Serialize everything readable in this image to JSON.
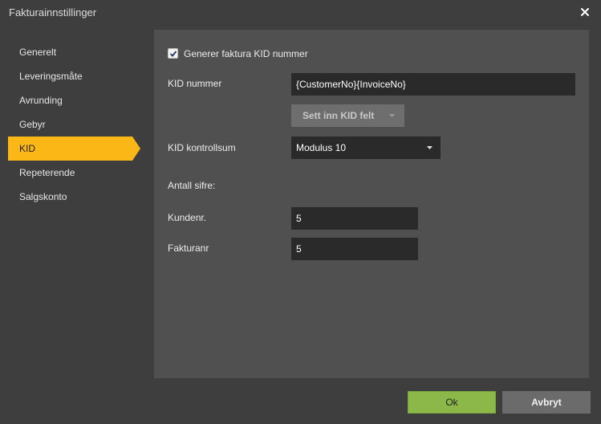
{
  "window": {
    "title": "Fakturainnstillinger"
  },
  "sidebar": {
    "items": [
      {
        "label": "Generelt"
      },
      {
        "label": "Leveringsmåte"
      },
      {
        "label": "Avrunding"
      },
      {
        "label": "Gebyr"
      },
      {
        "label": "KID",
        "active": true
      },
      {
        "label": "Repeterende"
      },
      {
        "label": "Salgskonto"
      }
    ]
  },
  "kid": {
    "generate_checkbox": {
      "label": "Generer faktura KID nummer",
      "checked": true
    },
    "kid_number": {
      "label": "KID nummer",
      "value": "{CustomerNo}{InvoiceNo}"
    },
    "insert_field_button": {
      "label": "Sett inn KID felt"
    },
    "checksum": {
      "label": "KID kontrollsum",
      "value": "Modulus 10"
    },
    "digits_heading": "Antall sifre:",
    "customer_no": {
      "label": "Kundenr.",
      "value": "5"
    },
    "invoice_no": {
      "label": "Fakturanr",
      "value": "5"
    }
  },
  "footer": {
    "ok_label": "Ok",
    "cancel_label": "Avbryt"
  },
  "colors": {
    "accent": "#fbb716",
    "ok": "#8cb84a"
  }
}
